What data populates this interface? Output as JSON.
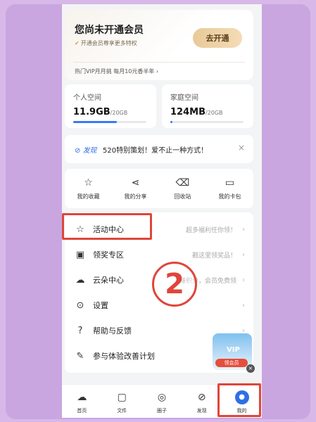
{
  "vip": {
    "title": "您尚未开通会员",
    "subtitle": "开通会员尊享更多特权",
    "open_button": "去开通",
    "promo": "热门VIP月月挑  每月10元香半年 ›"
  },
  "storage": {
    "personal": {
      "label": "个人空间",
      "used": "11.9GB",
      "total": "/20GB",
      "fill": 0.595
    },
    "family": {
      "label": "家庭空间",
      "used": "124MB",
      "total": "/20GB",
      "fill": 0.006
    }
  },
  "notice": {
    "tag": "发现",
    "text": "520特别策划！爱不止一种方式！",
    "close": "×"
  },
  "quick": [
    {
      "icon": "☆",
      "label": "我的收藏"
    },
    {
      "icon": "⋖",
      "label": "我的分享"
    },
    {
      "icon": "⌫",
      "label": "回收站"
    },
    {
      "icon": "▭",
      "label": "我的卡包"
    }
  ],
  "menu": [
    {
      "icon": "☆",
      "label": "活动中心",
      "hint": "超多福利任你领！",
      "arrow": "›"
    },
    {
      "icon": "▣",
      "label": "领奖专区",
      "hint": "戳这里领奖品！",
      "arrow": "›"
    },
    {
      "icon": "☁",
      "label": "云朵中心",
      "hint": "赚积分，会员免费领",
      "arrow": "›"
    },
    {
      "icon": "⊙",
      "label": "设置",
      "hint": "",
      "arrow": "›"
    },
    {
      "icon": "?",
      "label": "帮助与反馈",
      "hint": "",
      "arrow": "›"
    },
    {
      "icon": "✎",
      "label": "参与体验改善计划",
      "hint": "",
      "arrow": "›"
    }
  ],
  "annotation": {
    "step": "2"
  },
  "badge": {
    "text": "VIP",
    "label": "领会员",
    "close": "×"
  },
  "nav": [
    {
      "icon": "☁",
      "label": "首页",
      "active": false
    },
    {
      "icon": "▢",
      "label": "文件",
      "active": false
    },
    {
      "icon": "◎",
      "label": "圈子",
      "active": false
    },
    {
      "icon": "⊘",
      "label": "发现",
      "active": false
    },
    {
      "icon": "●",
      "label": "我的",
      "active": true
    }
  ],
  "colors": {
    "accent": "#2e6fe6",
    "highlight": "#e0453a",
    "gold": "#e9c999"
  }
}
